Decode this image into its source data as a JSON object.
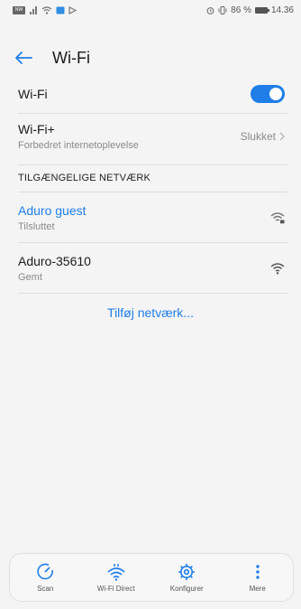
{
  "status_bar": {
    "sim_label": "NW",
    "battery_percent": "86 %",
    "time": "14.36"
  },
  "header": {
    "title": "Wi-Fi"
  },
  "wifi_toggle": {
    "label": "Wi-Fi",
    "enabled": true
  },
  "wifi_plus": {
    "title": "Wi-Fi+",
    "subtitle": "Forbedret internetoplevelse",
    "value": "Slukket"
  },
  "available_networks": {
    "header": "TILGÆNGELIGE NETVÆRK",
    "items": [
      {
        "name": "Aduro guest",
        "status": "Tilsluttet",
        "icon": "wifi-lock-icon"
      },
      {
        "name": "Aduro-35610",
        "status": "Gemt",
        "icon": "wifi-icon"
      }
    ]
  },
  "add_network": {
    "label": "Tilføj netværk..."
  },
  "bottom_nav": {
    "items": [
      {
        "label": "Scan",
        "icon": "scan-icon"
      },
      {
        "label": "Wi-Fi Direct",
        "icon": "wifi-direct-icon"
      },
      {
        "label": "Konfigurer",
        "icon": "gear-icon"
      },
      {
        "label": "Mere",
        "icon": "more-icon"
      }
    ]
  },
  "colors": {
    "accent": "#1f7ee8",
    "background": "#f4f4f4"
  }
}
